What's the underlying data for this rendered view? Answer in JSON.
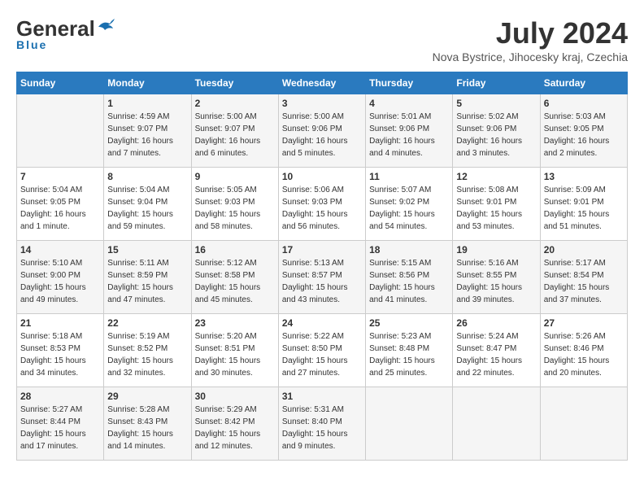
{
  "header": {
    "logo_general": "General",
    "logo_blue": "Blue",
    "month": "July 2024",
    "location": "Nova Bystrice, Jihocesky kraj, Czechia"
  },
  "calendar": {
    "days_of_week": [
      "Sunday",
      "Monday",
      "Tuesday",
      "Wednesday",
      "Thursday",
      "Friday",
      "Saturday"
    ],
    "weeks": [
      [
        {
          "day": "",
          "info": ""
        },
        {
          "day": "1",
          "info": "Sunrise: 4:59 AM\nSunset: 9:07 PM\nDaylight: 16 hours\nand 7 minutes."
        },
        {
          "day": "2",
          "info": "Sunrise: 5:00 AM\nSunset: 9:07 PM\nDaylight: 16 hours\nand 6 minutes."
        },
        {
          "day": "3",
          "info": "Sunrise: 5:00 AM\nSunset: 9:06 PM\nDaylight: 16 hours\nand 5 minutes."
        },
        {
          "day": "4",
          "info": "Sunrise: 5:01 AM\nSunset: 9:06 PM\nDaylight: 16 hours\nand 4 minutes."
        },
        {
          "day": "5",
          "info": "Sunrise: 5:02 AM\nSunset: 9:06 PM\nDaylight: 16 hours\nand 3 minutes."
        },
        {
          "day": "6",
          "info": "Sunrise: 5:03 AM\nSunset: 9:05 PM\nDaylight: 16 hours\nand 2 minutes."
        }
      ],
      [
        {
          "day": "7",
          "info": "Sunrise: 5:04 AM\nSunset: 9:05 PM\nDaylight: 16 hours\nand 1 minute."
        },
        {
          "day": "8",
          "info": "Sunrise: 5:04 AM\nSunset: 9:04 PM\nDaylight: 15 hours\nand 59 minutes."
        },
        {
          "day": "9",
          "info": "Sunrise: 5:05 AM\nSunset: 9:03 PM\nDaylight: 15 hours\nand 58 minutes."
        },
        {
          "day": "10",
          "info": "Sunrise: 5:06 AM\nSunset: 9:03 PM\nDaylight: 15 hours\nand 56 minutes."
        },
        {
          "day": "11",
          "info": "Sunrise: 5:07 AM\nSunset: 9:02 PM\nDaylight: 15 hours\nand 54 minutes."
        },
        {
          "day": "12",
          "info": "Sunrise: 5:08 AM\nSunset: 9:01 PM\nDaylight: 15 hours\nand 53 minutes."
        },
        {
          "day": "13",
          "info": "Sunrise: 5:09 AM\nSunset: 9:01 PM\nDaylight: 15 hours\nand 51 minutes."
        }
      ],
      [
        {
          "day": "14",
          "info": "Sunrise: 5:10 AM\nSunset: 9:00 PM\nDaylight: 15 hours\nand 49 minutes."
        },
        {
          "day": "15",
          "info": "Sunrise: 5:11 AM\nSunset: 8:59 PM\nDaylight: 15 hours\nand 47 minutes."
        },
        {
          "day": "16",
          "info": "Sunrise: 5:12 AM\nSunset: 8:58 PM\nDaylight: 15 hours\nand 45 minutes."
        },
        {
          "day": "17",
          "info": "Sunrise: 5:13 AM\nSunset: 8:57 PM\nDaylight: 15 hours\nand 43 minutes."
        },
        {
          "day": "18",
          "info": "Sunrise: 5:15 AM\nSunset: 8:56 PM\nDaylight: 15 hours\nand 41 minutes."
        },
        {
          "day": "19",
          "info": "Sunrise: 5:16 AM\nSunset: 8:55 PM\nDaylight: 15 hours\nand 39 minutes."
        },
        {
          "day": "20",
          "info": "Sunrise: 5:17 AM\nSunset: 8:54 PM\nDaylight: 15 hours\nand 37 minutes."
        }
      ],
      [
        {
          "day": "21",
          "info": "Sunrise: 5:18 AM\nSunset: 8:53 PM\nDaylight: 15 hours\nand 34 minutes."
        },
        {
          "day": "22",
          "info": "Sunrise: 5:19 AM\nSunset: 8:52 PM\nDaylight: 15 hours\nand 32 minutes."
        },
        {
          "day": "23",
          "info": "Sunrise: 5:20 AM\nSunset: 8:51 PM\nDaylight: 15 hours\nand 30 minutes."
        },
        {
          "day": "24",
          "info": "Sunrise: 5:22 AM\nSunset: 8:50 PM\nDaylight: 15 hours\nand 27 minutes."
        },
        {
          "day": "25",
          "info": "Sunrise: 5:23 AM\nSunset: 8:48 PM\nDaylight: 15 hours\nand 25 minutes."
        },
        {
          "day": "26",
          "info": "Sunrise: 5:24 AM\nSunset: 8:47 PM\nDaylight: 15 hours\nand 22 minutes."
        },
        {
          "day": "27",
          "info": "Sunrise: 5:26 AM\nSunset: 8:46 PM\nDaylight: 15 hours\nand 20 minutes."
        }
      ],
      [
        {
          "day": "28",
          "info": "Sunrise: 5:27 AM\nSunset: 8:44 PM\nDaylight: 15 hours\nand 17 minutes."
        },
        {
          "day": "29",
          "info": "Sunrise: 5:28 AM\nSunset: 8:43 PM\nDaylight: 15 hours\nand 14 minutes."
        },
        {
          "day": "30",
          "info": "Sunrise: 5:29 AM\nSunset: 8:42 PM\nDaylight: 15 hours\nand 12 minutes."
        },
        {
          "day": "31",
          "info": "Sunrise: 5:31 AM\nSunset: 8:40 PM\nDaylight: 15 hours\nand 9 minutes."
        },
        {
          "day": "",
          "info": ""
        },
        {
          "day": "",
          "info": ""
        },
        {
          "day": "",
          "info": ""
        }
      ]
    ]
  }
}
